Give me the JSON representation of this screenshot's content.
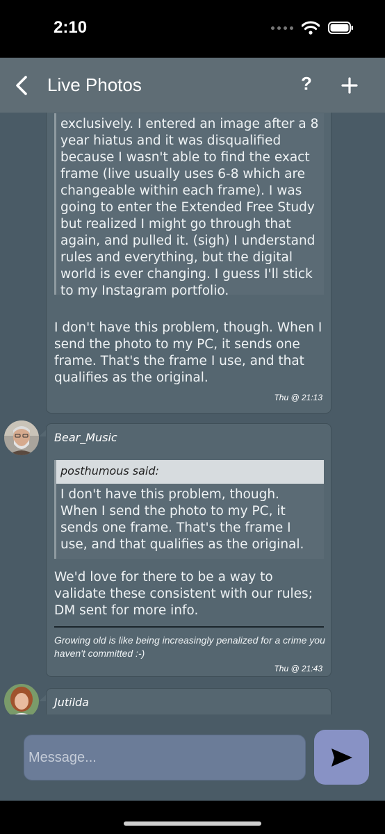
{
  "status_bar": {
    "time": "2:10"
  },
  "nav": {
    "title": "Live Photos",
    "help_label": "?",
    "back_icon": "chevron-left-icon",
    "add_icon": "plus-icon"
  },
  "messages": [
    {
      "quote_body": "exclusively.  I entered an image after a 8 year hiatus and it was disqualified because I wasn't able to find the exact frame (live usually uses 6-8 which are changeable within each frame).  I was going to enter the Extended Free Study but realized I might go through that again, and pulled it. (sigh)  I understand rules and everything, but the digital world is ever changing.  I guess I'll stick to my Instagram portfolio.",
      "body": "I don't have this problem, though. When I send the photo to my PC, it sends one frame. That's the frame I use, and that qualifies as the original.",
      "timestamp": "Thu @ 21:13"
    },
    {
      "author": "Bear_Music",
      "quote_header": "posthumous said:",
      "quote_body": "I don't have this problem, though. When I send the photo to my PC, it sends one frame. That's the frame I use, and that qualifies as the original.",
      "body": "We'd love for there to be a way to validate these consistent with our rules; DM sent for more info.",
      "signature": "Growing old is like being increasingly penalized for a crime you haven't committed :-)",
      "timestamp": "Thu @ 21:43"
    },
    {
      "author": "Jutilda"
    }
  ],
  "composer": {
    "placeholder": "Message...",
    "send_icon": "send-icon"
  },
  "colors": {
    "chat_bg": "#4a5b66",
    "bubble_bg": "#556670",
    "nav_bg": "#5f6d75",
    "send_bg": "#8892c5",
    "input_bg": "#6b7c98"
  }
}
